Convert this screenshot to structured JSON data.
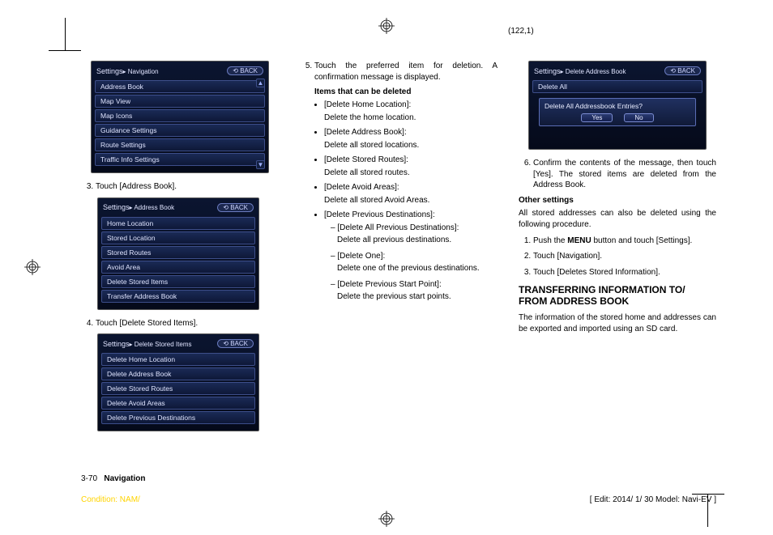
{
  "page_coord": "(122,1)",
  "screenshots": {
    "settings_nav": {
      "title": "Settings",
      "breadcrumb": "Navigation",
      "back": "BACK",
      "items": [
        "Address Book",
        "Map View",
        "Map Icons",
        "Guidance Settings",
        "Route Settings",
        "Traffic Info Settings"
      ]
    },
    "address_book": {
      "title": "Settings",
      "breadcrumb": "Address Book",
      "back": "BACK",
      "items": [
        "Home Location",
        "Stored Location",
        "Stored Routes",
        "Avoid Area",
        "Delete Stored Items",
        "Transfer Address Book"
      ]
    },
    "delete_stored": {
      "title": "Settings",
      "breadcrumb": "Delete Stored Items",
      "back": "BACK",
      "items": [
        "Delete Home Location",
        "Delete Address Book",
        "Delete Stored Routes",
        "Delete Avoid Areas",
        "Delete Previous Destinations"
      ]
    },
    "delete_confirm": {
      "title": "Settings",
      "breadcrumb": "Delete Address Book",
      "back": "BACK",
      "top_item": "Delete All",
      "message": "Delete All Addressbook Entries?",
      "yes": "Yes",
      "no": "No"
    }
  },
  "col1": {
    "step3": "Touch [Address Book].",
    "step4": "Touch [Delete Stored Items]."
  },
  "col2": {
    "step5": "Touch the preferred item for deletion. A confirmation message is displayed.",
    "items_heading": "Items that can be deleted",
    "bullets": [
      {
        "label": "[Delete Home Location]:",
        "desc": "Delete the home location."
      },
      {
        "label": "[Delete Address Book]:",
        "desc": "Delete all stored locations."
      },
      {
        "label": "[Delete Stored Routes]:",
        "desc": "Delete all stored routes."
      },
      {
        "label": "[Delete Avoid Areas]:",
        "desc": "Delete all stored Avoid Areas."
      },
      {
        "label": "[Delete Previous Destinations]:",
        "desc": ""
      }
    ],
    "dashes": [
      {
        "label": "[Delete All Previous Destinations]:",
        "desc": "Delete all previous destinations."
      },
      {
        "label": "[Delete One]:",
        "desc": "Delete one of the previous destinations."
      },
      {
        "label": "[Delete Previous Start Point]:",
        "desc": "Delete the previous start points."
      }
    ]
  },
  "col3": {
    "step6": "Confirm the contents of the message, then touch [Yes]. The stored items are deleted from the Address Book.",
    "other_heading": "Other settings",
    "other_para": "All stored addresses can also be deleted using the following procedure.",
    "other_steps_1a": "Push the ",
    "other_steps_1b": "MENU",
    "other_steps_1c": " button and touch [Settings].",
    "other_steps_2": "Touch [Navigation].",
    "other_steps_3": "Touch [Deletes Stored Information].",
    "h2_line1": "TRANSFERRING INFORMATION TO/",
    "h2_line2": "FROM ADDRESS BOOK",
    "transfer_para": "The information of the stored home and addresses can be exported and imported using an SD card."
  },
  "footer": {
    "page_num": "3-70",
    "section": "Navigation",
    "condition": "Condition: NAM/",
    "edit": "[ Edit: 2014/ 1/ 30   Model:  Navi-EV ]"
  }
}
